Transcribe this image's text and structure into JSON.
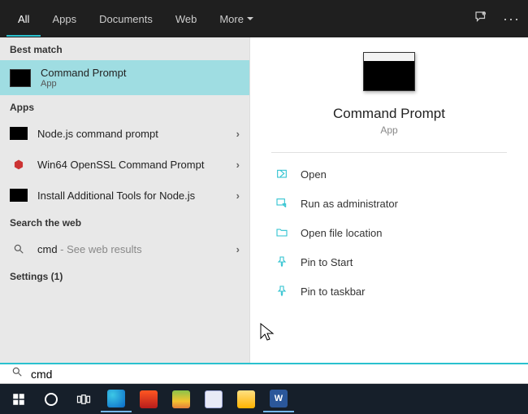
{
  "tabs": {
    "items": [
      {
        "label": "All",
        "active": true
      },
      {
        "label": "Apps"
      },
      {
        "label": "Documents"
      },
      {
        "label": "Web"
      },
      {
        "label": "More"
      }
    ]
  },
  "sections": {
    "best_match": "Best match",
    "apps": "Apps",
    "search_web": "Search the web",
    "settings": "Settings (1)"
  },
  "best_match": {
    "title": "Command Prompt",
    "subtitle": "App"
  },
  "apps_list": [
    {
      "label": "Node.js command prompt",
      "iconType": "black"
    },
    {
      "label": "Win64 OpenSSL Command Prompt",
      "iconType": "openssl"
    },
    {
      "label": "Install Additional Tools for Node.js",
      "iconType": "black"
    }
  ],
  "web": {
    "query": "cmd",
    "hint": " - See web results"
  },
  "details": {
    "title": "Command Prompt",
    "subtitle": "App",
    "actions": [
      {
        "label": "Open",
        "icon": "open"
      },
      {
        "label": "Run as administrator",
        "icon": "admin"
      },
      {
        "label": "Open file location",
        "icon": "folder"
      },
      {
        "label": "Pin to Start",
        "icon": "pin"
      },
      {
        "label": "Pin to taskbar",
        "icon": "pin"
      }
    ]
  },
  "search": {
    "value": "cmd"
  },
  "taskbar": {
    "items": [
      "start",
      "cortana",
      "taskview",
      "edge",
      "brave",
      "paint",
      "seal",
      "explorer",
      "word"
    ]
  }
}
